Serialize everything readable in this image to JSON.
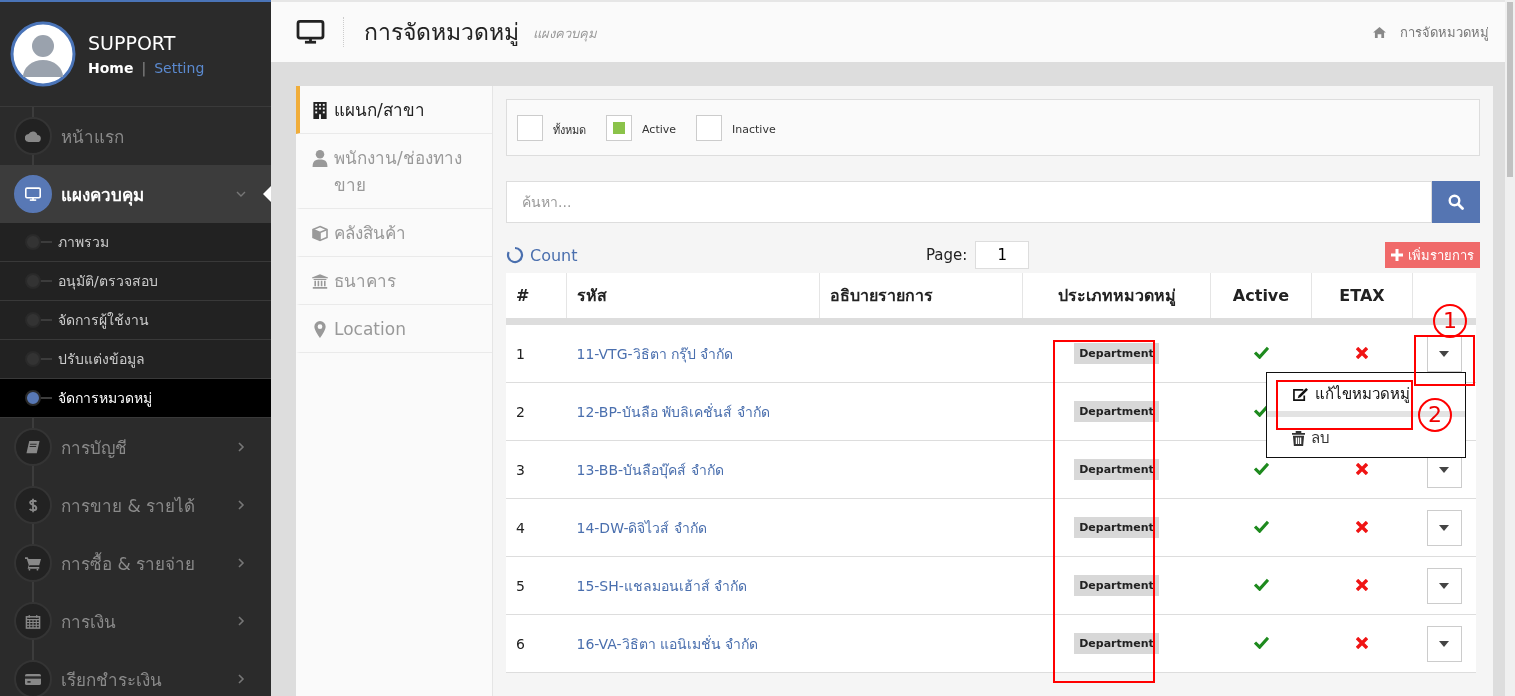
{
  "sidebar": {
    "profile": {
      "name": "SUPPORT",
      "separator": "|",
      "links": [
        {
          "label": "Home",
          "selected": true
        },
        {
          "label": "Setting",
          "selected": false
        }
      ]
    },
    "menu": [
      {
        "label": "หน้าแรก",
        "kind": "link",
        "selected": false
      },
      {
        "label": "แผงควบคุม",
        "kind": "group",
        "selected": true,
        "expanded": true,
        "children": [
          {
            "label": "ภาพรวม",
            "selected": false
          },
          {
            "label": "อนุมัติ/ตรวจสอบ",
            "selected": false
          },
          {
            "label": "จัดการผู้ใช้งาน",
            "selected": false
          },
          {
            "label": "ปรับแต่งข้อมูล",
            "selected": false
          },
          {
            "label": "จัดการหมวดหมู่",
            "selected": true
          }
        ]
      },
      {
        "label": "การบัญชี",
        "kind": "group",
        "selected": false,
        "expanded": false
      },
      {
        "label": "การขาย & รายได้",
        "kind": "group",
        "selected": false,
        "expanded": false
      },
      {
        "label": "การซื้อ & รายจ่าย",
        "kind": "group",
        "selected": false,
        "expanded": false
      },
      {
        "label": "การเงิน",
        "kind": "group",
        "selected": false,
        "expanded": false
      },
      {
        "label": "เรียกชำระเงิน",
        "kind": "group",
        "selected": false,
        "expanded": false
      }
    ]
  },
  "header": {
    "title": "การจัดหมวดหมู่",
    "subtitle": "แผงควบคุม",
    "breadcrumb": "การจัดหมวดหมู่"
  },
  "tabs": [
    {
      "label": "แผนก/สาขา",
      "selected": true
    },
    {
      "label": "พนักงาน/ช่องทางขาย",
      "selected": false
    },
    {
      "label": "คลังสินค้า",
      "selected": false
    },
    {
      "label": "ธนาคาร",
      "selected": false
    },
    {
      "label": "Location",
      "selected": false
    }
  ],
  "filters": [
    {
      "label": "ทั้งหมด",
      "checked": false
    },
    {
      "label": "Active",
      "checked": true
    },
    {
      "label": "Inactive",
      "checked": false
    }
  ],
  "search": {
    "placeholder": "ค้นหา..."
  },
  "toolbar": {
    "count_label": "Count",
    "page_label": "Page:",
    "page": "1",
    "add_button": "เพิ่มรายการ"
  },
  "table": {
    "columns": [
      "#",
      "รหัส",
      "อธิบายรายการ",
      "ประเภทหมวดหมู่",
      "Active",
      "ETAX"
    ],
    "rows": [
      {
        "number": "1",
        "code": "11-VTG-วิธิตา กรุ๊ป จำกัด",
        "type": "Department",
        "active": true,
        "etax": false,
        "menu_open": true
      },
      {
        "number": "2",
        "code": "12-BP-บันลือ พับลิเคชั่นส์ จำกัด",
        "type": "Department",
        "active": true
      },
      {
        "number": "3",
        "code": "13-BB-บันลือบุ๊คส์ จำกัด",
        "type": "Department",
        "active": true,
        "etax": false,
        "menu_open": false
      },
      {
        "number": "4",
        "code": "14-DW-ดิจิไวส์ จำกัด",
        "type": "Department",
        "active": true,
        "etax": false,
        "menu_open": false
      },
      {
        "number": "5",
        "code": "15-SH-แชลมอนเฮ้าส์ จำกัด",
        "type": "Department",
        "active": true,
        "etax": false,
        "menu_open": false
      },
      {
        "number": "6",
        "code": "16-VA-วิธิตา แอนิเมชั่น จำกัด",
        "type": "Department",
        "active": true,
        "etax": false,
        "menu_open": false
      }
    ]
  },
  "row_menu": [
    {
      "label": "แก้ไขหมวดหมู่",
      "selected": true
    },
    {
      "label": "ลบ",
      "selected": false
    }
  ],
  "annotations": [
    {
      "number": "1"
    },
    {
      "number": "2"
    }
  ]
}
